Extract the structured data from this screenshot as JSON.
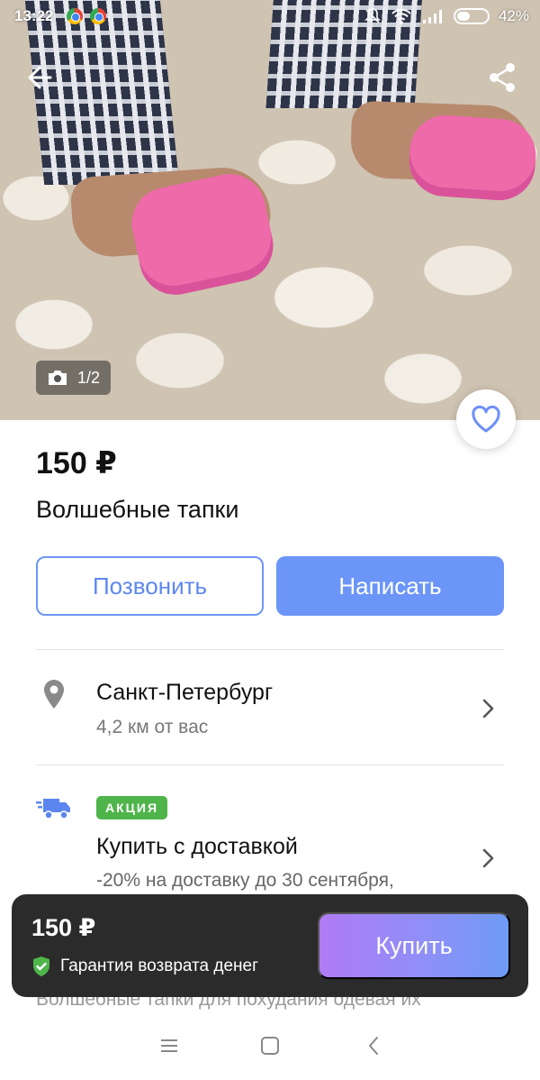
{
  "status_bar": {
    "time": "13:22",
    "battery": "42%"
  },
  "gallery": {
    "counter": "1/2"
  },
  "listing": {
    "price": "150 ₽",
    "title": "Волшебные тапки"
  },
  "actions": {
    "call_label": "Позвонить",
    "message_label": "Написать"
  },
  "location": {
    "city": "Санкт-Петербург",
    "distance": "4,2 км от вас"
  },
  "delivery": {
    "badge": "АКЦИЯ",
    "title": "Купить с доставкой",
    "subtitle": "-20% на доставку до 30 сентября,"
  },
  "description_peek": "Волшебные тапки для похудания одевая их",
  "buy_bar": {
    "price": "150 ₽",
    "guarantee": "Гарантия возврата денег",
    "buy_label": "Купить"
  },
  "colors": {
    "accent_blue": "#6b95f7",
    "promo_green": "#4fb54a",
    "buy_bar_bg": "#2b2b2b"
  },
  "icons": [
    "arrow-left-icon",
    "share-icon",
    "camera-icon",
    "heart-icon",
    "location-pin-icon",
    "chevron-right-icon",
    "delivery-truck-icon",
    "shield-check-icon",
    "menu-icon",
    "home-square-icon",
    "back-triangle-icon"
  ]
}
